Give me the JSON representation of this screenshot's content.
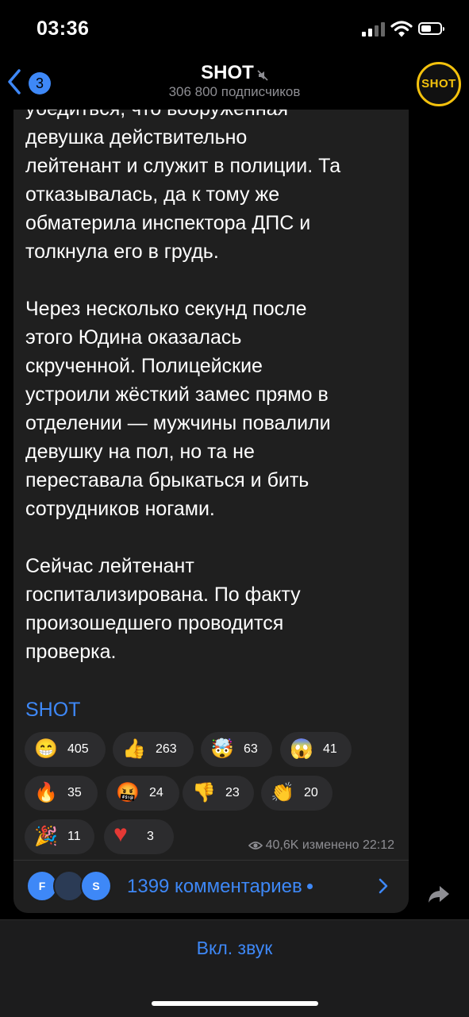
{
  "status_bar": {
    "time": "03:36",
    "battery_level": 0.3
  },
  "header": {
    "back_badge": "3",
    "title": "SHOT",
    "subscribers": "306 800 подписчиков",
    "avatar_text": "SHOT",
    "accent_color": "#f4c20d"
  },
  "message": {
    "partial_top_line": "убедиться, что вооружённая",
    "paragraphs": [
      "девушка действительно\nлейтенант и служит в полиции. Та\nотказывалась, да к тому же\nобматерила инспектора ДПС и\nтолкнула его в грудь.",
      "Через несколько секунд после\nэтого Юдина оказалась\nскрученной. Полицейские\nустроили жёсткий замес прямо в\nотделении — мужчины повалили\nдевушку на пол, но та не\nпереставала брыкаться и бить\nсотрудников ногами.",
      "Сейчас лейтенант\nгоспитализирована. По факту\nпроизошедшего проводится\nпроверка."
    ],
    "signature": "SHOT",
    "reactions": [
      {
        "emoji": "😁",
        "count": "405"
      },
      {
        "emoji": "👍",
        "count": "263"
      },
      {
        "emoji": "🤯",
        "count": "63"
      },
      {
        "emoji": "😱",
        "count": "41"
      },
      {
        "emoji": "🔥",
        "count": "35"
      },
      {
        "emoji": "🤬",
        "count": "24"
      },
      {
        "emoji": "👎",
        "count": "23"
      },
      {
        "emoji": "👏",
        "count": "20"
      },
      {
        "emoji": "🎉",
        "count": "11"
      },
      {
        "emoji": "♥",
        "count": "3"
      }
    ],
    "views": "40,6K",
    "edited_label": "изменено",
    "edited_time": "22:12"
  },
  "comments": {
    "avatars": [
      "F",
      "",
      "S"
    ],
    "label": "1399 комментариев"
  },
  "bottom": {
    "sound_button": "Вкл. звук"
  },
  "colors": {
    "link": "#3e88f7",
    "bubble": "#1f1f1f",
    "background": "#000000"
  }
}
